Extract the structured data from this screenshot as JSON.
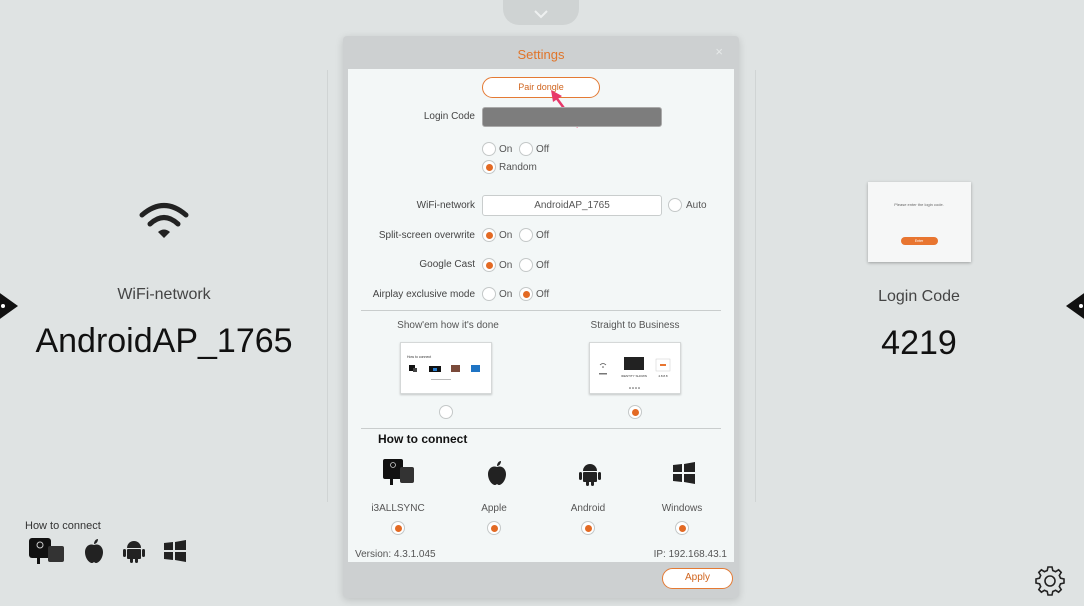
{
  "background": {
    "wifi_label": "WiFi-network",
    "wifi_value": "AndroidAP_1765",
    "login_label": "Login Code",
    "login_value": "4219",
    "preview_text": "Please enter the login code.",
    "preview_button": "Enter",
    "how_to_connect": "How to connect"
  },
  "dialog": {
    "title": "Settings",
    "close": "×",
    "pair_dongle": "Pair dongle",
    "login_code_label": "Login Code",
    "on_label": "On",
    "off_label": "Off",
    "random_label": "Random",
    "wifi_label": "WiFi-network",
    "wifi_value": "AndroidAP_1765",
    "auto_label": "Auto",
    "split_label": "Split-screen overwrite",
    "cast_label": "Google Cast",
    "airplay_label": "Airplay exclusive mode",
    "option_a": "Show'em how it's done",
    "option_b": "Straight to Business",
    "thumb_a_text": "How to connect",
    "thumb_b_text": "IDENTITY SHOWN",
    "thumb_b_code": "4.8.8.8",
    "how_to_connect": "How to connect",
    "os": [
      "i3ALLSYNC",
      "Apple",
      "Android",
      "Windows"
    ],
    "version": "Version: 4.3.1.045",
    "ip": "IP: 192.168.43.1",
    "apply": "Apply"
  },
  "colors": {
    "accent": "#e36a24",
    "background": "#dfe3e3"
  }
}
